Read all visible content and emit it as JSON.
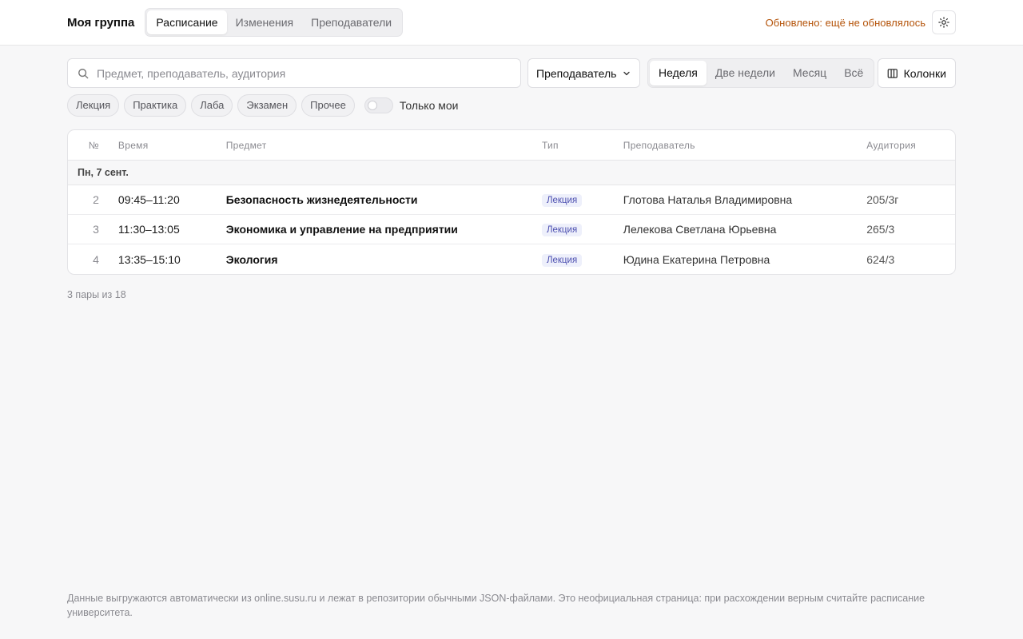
{
  "header": {
    "brand": "Моя группа",
    "tabs": [
      "Расписание",
      "Изменения",
      "Преподаватели"
    ],
    "active_tab": 0,
    "updated_text": "Обновлено: ещё не обновлялось"
  },
  "controls": {
    "search_placeholder": "Предмет, преподаватель, аудитория",
    "search_value": "",
    "mode_select": "Преподаватель",
    "ranges": [
      "Неделя",
      "Две недели",
      "Месяц",
      "Всё"
    ],
    "active_range": 0,
    "columns_label": "Колонки"
  },
  "filters": {
    "chips": [
      "Лекция",
      "Практика",
      "Лаба",
      "Экзамен",
      "Прочее"
    ],
    "only_mine_label": "Только мои",
    "only_mine": false
  },
  "table": {
    "columns": [
      "№",
      "Время",
      "Предмет",
      "Тип",
      "Преподаватель",
      "Аудитория"
    ],
    "group_label": "Пн, 7 сент.",
    "rows": [
      {
        "num": "2",
        "time": "09:45–11:20",
        "subject": "Безопасность жизнедеятельности",
        "type": "Лекция",
        "teacher": "Глотова Наталья Владимировна",
        "room": "205/3г"
      },
      {
        "num": "3",
        "time": "11:30–13:05",
        "subject": "Экономика и управление на предприятии",
        "type": "Лекция",
        "teacher": "Лелекова Светлана Юрьевна",
        "room": "265/3"
      },
      {
        "num": "4",
        "time": "13:35–15:10",
        "subject": "Экология",
        "type": "Лекция",
        "teacher": "Юдина Екатерина Петровна",
        "room": "624/3"
      }
    ]
  },
  "count_text": "3 пары из 18",
  "footer_text": "Данные выгружаются автоматически из online.susu.ru и лежат в репозитории обычными JSON-файлами. Это неофициальная страница: при расхождении верным считайте расписание университета.",
  "colors": {
    "accent_warning": "#b45309",
    "badge_bg": "#eef0fb",
    "badge_text": "#4c4fb0"
  }
}
